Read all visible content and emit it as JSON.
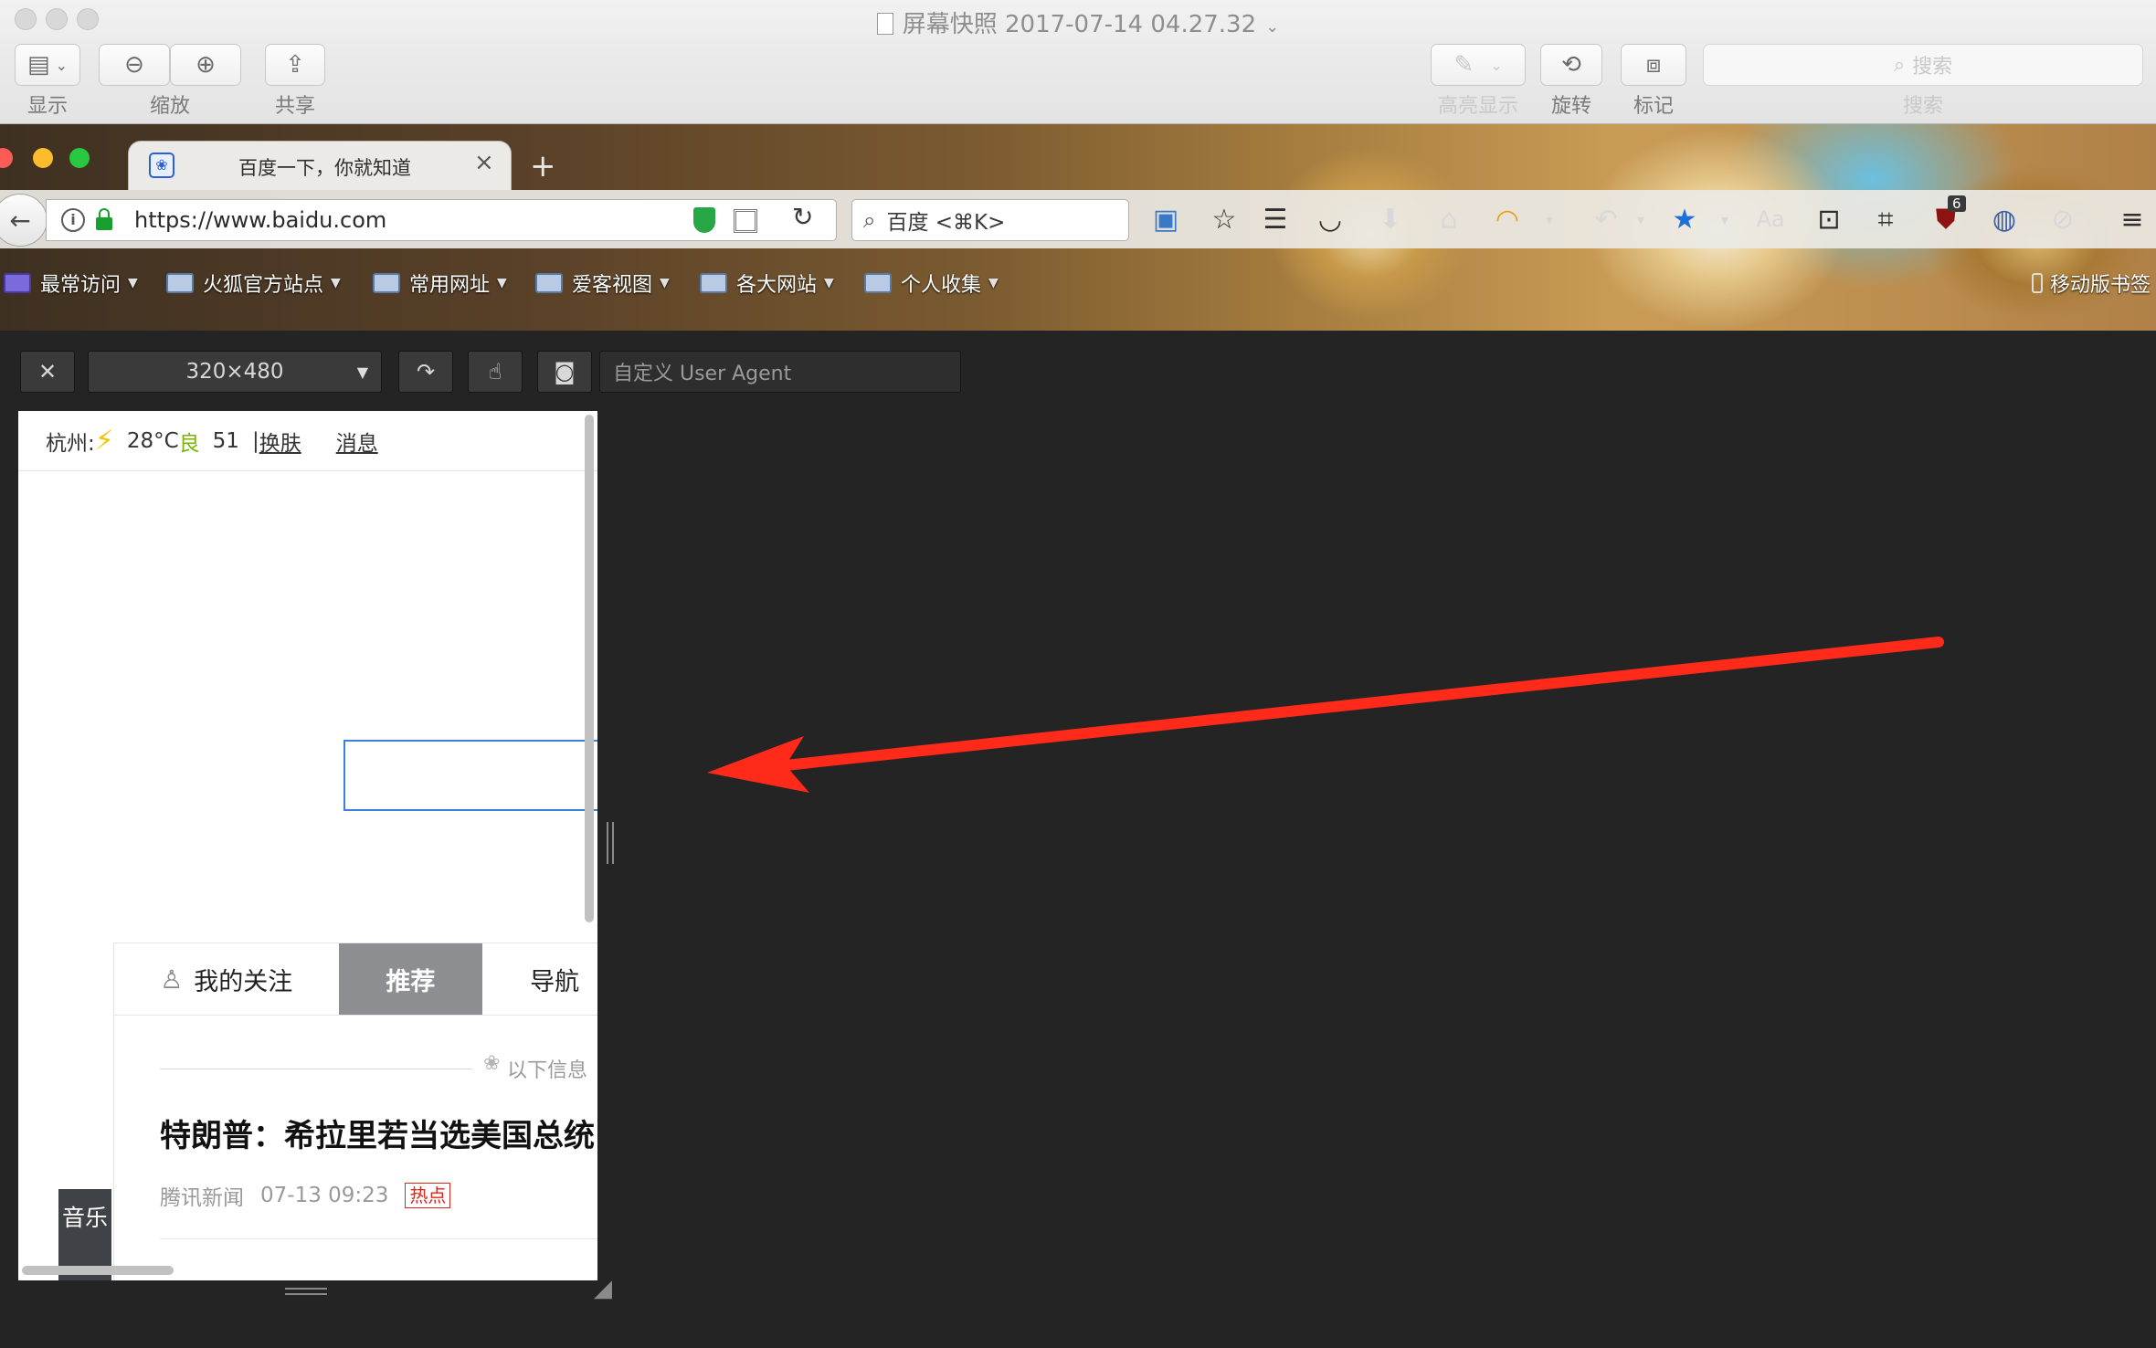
{
  "preview": {
    "title": "屏幕快照 2017-07-14 04.27.32",
    "toolbar": {
      "display_label": "显示",
      "zoom_label": "缩放",
      "share_label": "共享",
      "highlight_label": "高亮显示",
      "rotate_label": "旋转",
      "markup_label": "标记",
      "search_label": "搜索",
      "search_placeholder": "搜索"
    }
  },
  "firefox": {
    "tab_title": "百度一下，你就知道",
    "url": "https://www.baidu.com",
    "search_placeholder": "百度 <⌘K>",
    "ublock_badge": "6",
    "bookmarks": [
      {
        "label": "最常访问"
      },
      {
        "label": "火狐官方站点"
      },
      {
        "label": "常用网址"
      },
      {
        "label": "爱客视图"
      },
      {
        "label": "各大网站"
      },
      {
        "label": "个人收集"
      }
    ],
    "mobile_bookmarks": "移动版书签"
  },
  "rdm": {
    "size": "320×480",
    "user_agent_placeholder": "自定义 User Agent"
  },
  "mobile": {
    "weather": {
      "city": "杭州:",
      "temp": "28°C",
      "aqi_label": "良",
      "aqi_value": "51",
      "sep": "|",
      "skin": "换肤",
      "msg": "消息"
    },
    "tabs": {
      "follow": "我的关注",
      "recommend": "推荐",
      "nav": "导航"
    },
    "below_info": "以下信息",
    "headline": "特朗普：希拉里若当选美国总统",
    "source": "腾讯新闻",
    "time": "07-13 09:23",
    "hot": "热点",
    "music": "音乐"
  },
  "colors": {
    "arrow": "#ff2a1a",
    "search_focus": "#3c7fe0",
    "hot": "#e2231a"
  }
}
